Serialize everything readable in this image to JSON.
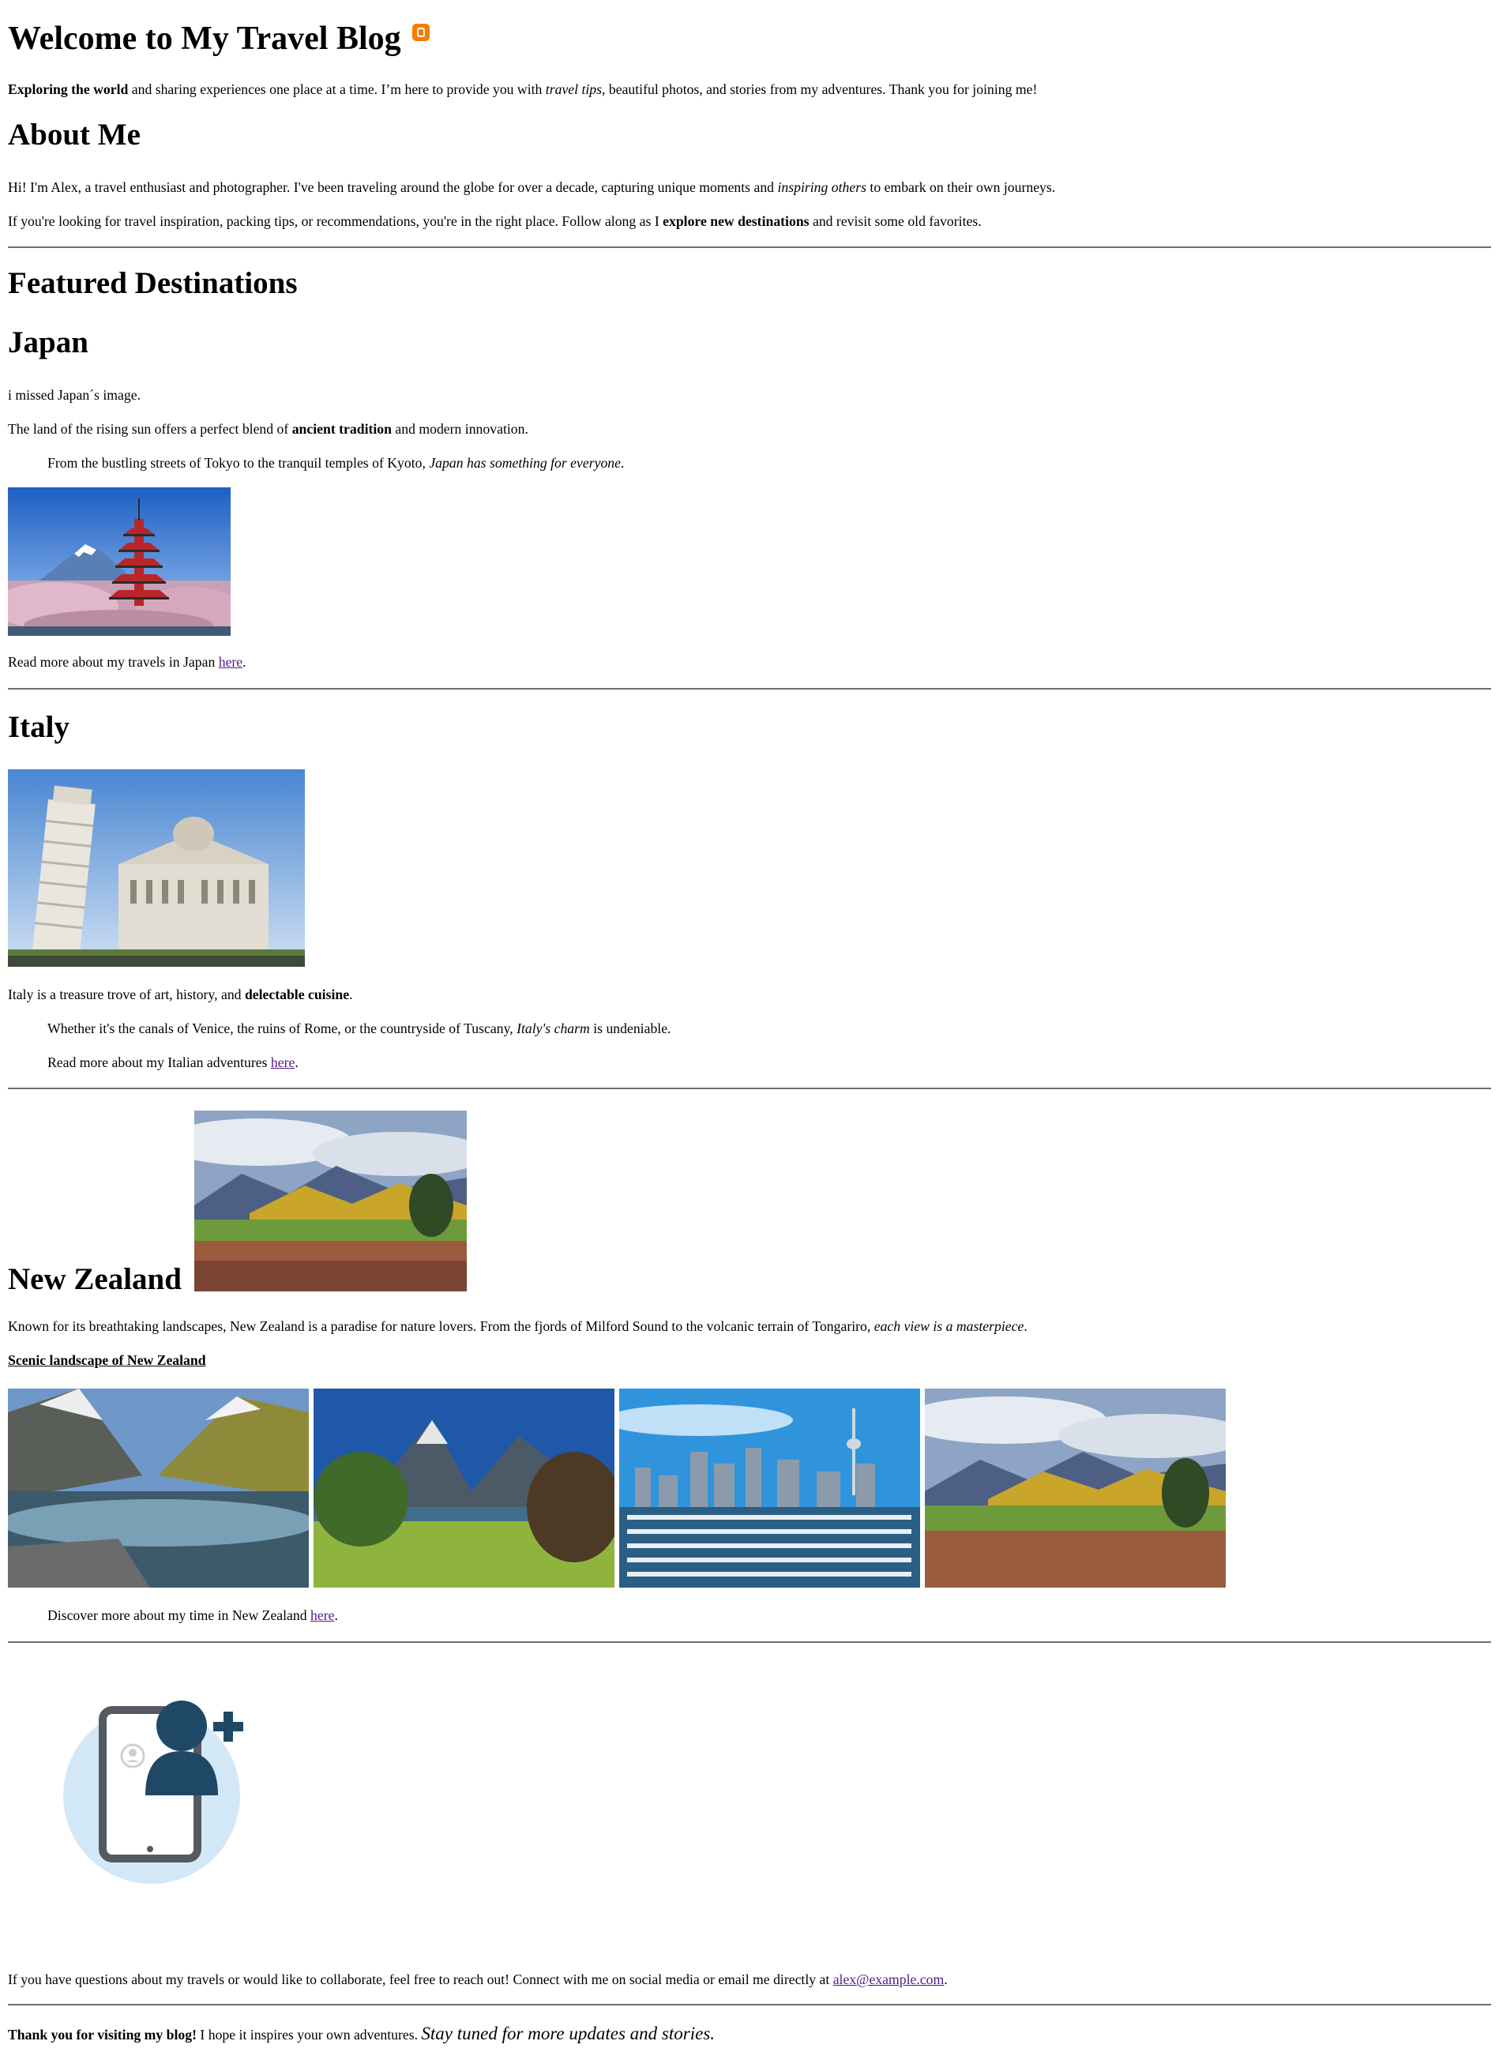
{
  "header": {
    "title": "Welcome to My Travel Blog",
    "intro_bold": "Exploring the world",
    "intro_1": " and sharing experiences one place at a time. I’m here to provide you with ",
    "intro_italic": "travel tips",
    "intro_2": ", beautiful photos, and stories from my adventures. Thank you for joining me!"
  },
  "about": {
    "heading": "About Me",
    "p1_a": "Hi! I'm Alex, a travel enthusiast and photographer. I've been traveling around the globe for over a decade, capturing unique moments and ",
    "p1_italic": "inspiring others",
    "p1_b": " to embark on their own journeys.",
    "p2_a": "If you're looking for travel inspiration, packing tips, or recommendations, you're in the right place. Follow along as I ",
    "p2_bold": "explore new destinations",
    "p2_b": " and revisit some old favorites."
  },
  "featured": {
    "heading": "Featured Destinations"
  },
  "japan": {
    "heading": "Japan",
    "missed": "i missed Japan´s image.",
    "p1_a": "The land of the rising sun offers a perfect blend of ",
    "p1_bold": "ancient tradition",
    "p1_b": " and modern innovation.",
    "p2_a": "From the bustling streets of Tokyo to the tranquil temples of Kyoto, ",
    "p2_italic": "Japan has something for everyone",
    "p2_b": ".",
    "read_a": "Read more about my travels in Japan ",
    "read_link": "here",
    "read_b": "."
  },
  "italy": {
    "heading": "Italy",
    "p1_a": "Italy is a treasure trove of art, history, and ",
    "p1_bold": "delectable cuisine",
    "p1_b": ".",
    "p2_a": "Whether it's the canals of Venice, the ruins of Rome, or the countryside of Tuscany, ",
    "p2_italic": "Italy's charm",
    "p2_b": " is undeniable.",
    "read_a": "Read more about my Italian adventures ",
    "read_link": "here",
    "read_b": "."
  },
  "nz": {
    "heading": "New Zealand",
    "p1_a": "Known for its breathtaking landscapes, New Zealand is a paradise for nature lovers. From the fjords of Milford Sound to the volcanic terrain of Tongariro, ",
    "p1_italic": "each view is a masterpiece",
    "p1_b": ".",
    "caption": "Scenic landscape of New Zealand",
    "read_a": "Discover more about my time in New Zealand ",
    "read_link": "here",
    "read_b": "."
  },
  "contact": {
    "text": "If you have questions about my travels or would like to collaborate, feel free to reach out! Connect with me on social media or email me directly at ",
    "email": "alex@example.com",
    "text_end": "."
  },
  "footer": {
    "bold": "Thank you for visiting my blog!",
    "text": " I hope it inspires your own adventures. ",
    "italic": "Stay tuned for more updates and stories."
  },
  "colors": {
    "link": "#551a8b",
    "rule": "#6e6e6e",
    "blogger": "#f57d00",
    "contact_circle": "#d3e8f7",
    "contact_dark": "#1f4866"
  }
}
